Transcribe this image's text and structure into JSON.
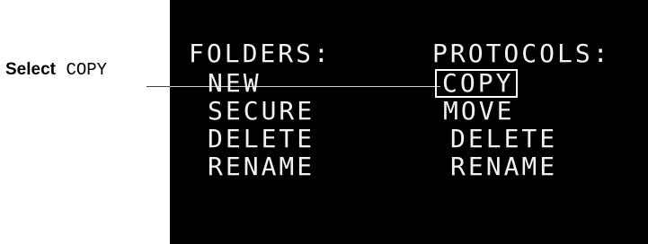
{
  "callout": {
    "bold": "Select",
    "mono": "COPY"
  },
  "folders": {
    "heading": "FOLDERS:",
    "items": [
      "NEW",
      "SECURE",
      "DELETE",
      "RENAME"
    ]
  },
  "protocols": {
    "heading": "PROTOCOLS:",
    "items": [
      "COPY",
      "MOVE",
      "DELETE",
      "RENAME"
    ],
    "selected": "COPY"
  },
  "colors": {
    "screen_bg": "#000000",
    "screen_text": "#f2f2f2",
    "highlight_border": "#ffffff"
  }
}
